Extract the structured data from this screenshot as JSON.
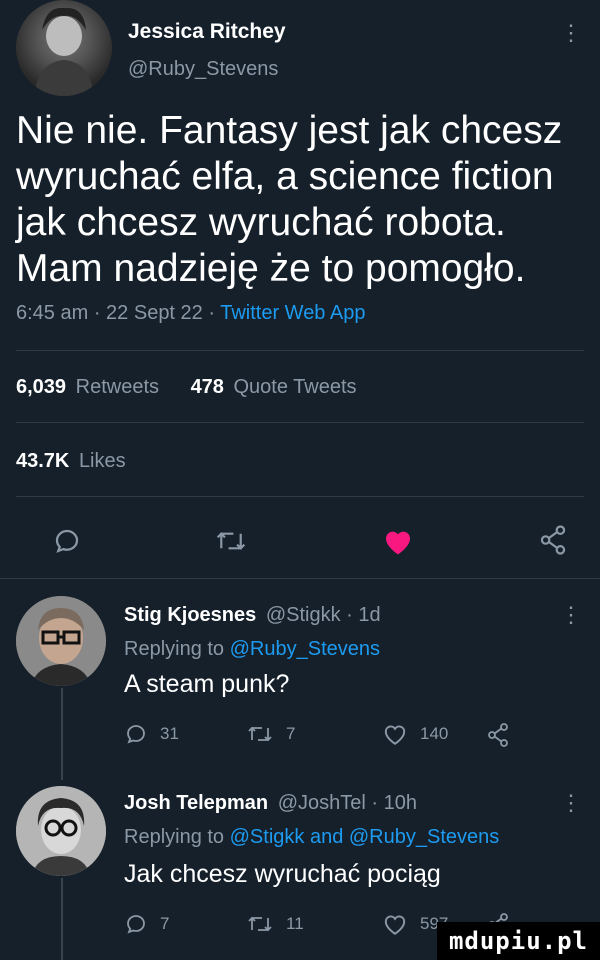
{
  "main_tweet": {
    "author_name": "Jessica Ritchey",
    "author_handle": "@Ruby_Stevens",
    "text_lines": [
      "Nie nie. Fantasy jest jak chcesz",
      "wyruchać elfa, a science fiction",
      "jak chcesz wyruchać robota.",
      "Mam nadzieję że to pomogło."
    ],
    "time": "6:45 am",
    "date": "22 Sept 22",
    "source": "Twitter Web App",
    "retweets_count": "6,039",
    "retweets_label": "Retweets",
    "quotes_count": "478",
    "quotes_label": "Quote Tweets",
    "likes_count": "43.7K",
    "likes_label": "Likes"
  },
  "replies": [
    {
      "name": "Stig Kjoesnes",
      "handle": "@Stigkk",
      "age": "1d",
      "replying_label": "Replying to",
      "replying_to": "@Ruby_Stevens",
      "text": "A steam punk?",
      "comments": "31",
      "retweets": "7",
      "likes": "140"
    },
    {
      "name": "Josh Telepman",
      "handle": "@JoshTel",
      "age": "10h",
      "replying_label": "Replying to",
      "replying_to": "@Stigkk and @Ruby_Stevens",
      "text": "Jak chcesz wyruchać pociąg",
      "comments": "7",
      "retweets": "11",
      "likes": "597"
    }
  ],
  "watermark": "mdupiu.pl",
  "colors": {
    "background": "#15202b",
    "muted": "#8b98a5",
    "link": "#1d9bf0",
    "like_active": "#f91880"
  }
}
